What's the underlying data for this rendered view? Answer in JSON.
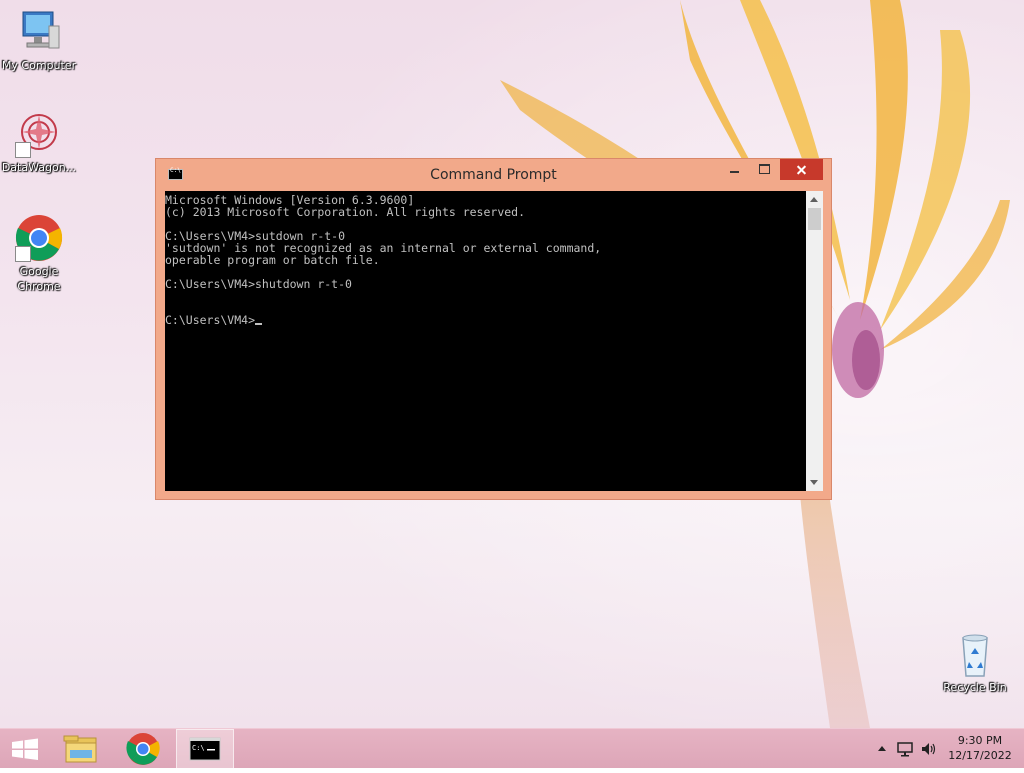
{
  "desktop": {
    "icons": [
      {
        "label": "My Computer"
      },
      {
        "label": "DataWagon..."
      },
      {
        "label": "Google Chrome"
      },
      {
        "label": "Recycle Bin"
      }
    ]
  },
  "cmd_window": {
    "title": "Command Prompt",
    "lines": [
      "Microsoft Windows [Version 6.3.9600]",
      "(c) 2013 Microsoft Corporation. All rights reserved.",
      "",
      "C:\\Users\\VM4>sutdown r-t-0",
      "'sutdown' is not recognized as an internal or external command,",
      "operable program or batch file.",
      "",
      "C:\\Users\\VM4>shutdown r-t-0",
      "",
      "",
      "C:\\Users\\VM4>"
    ]
  },
  "taskbar": {
    "time": "9:30 PM",
    "date": "12/17/2022"
  },
  "colors": {
    "window_frame": "#f2a98a",
    "close_button": "#c7392b",
    "taskbar": "#e0aabc",
    "console_bg": "#000000",
    "console_fg": "#c0c0c0"
  }
}
